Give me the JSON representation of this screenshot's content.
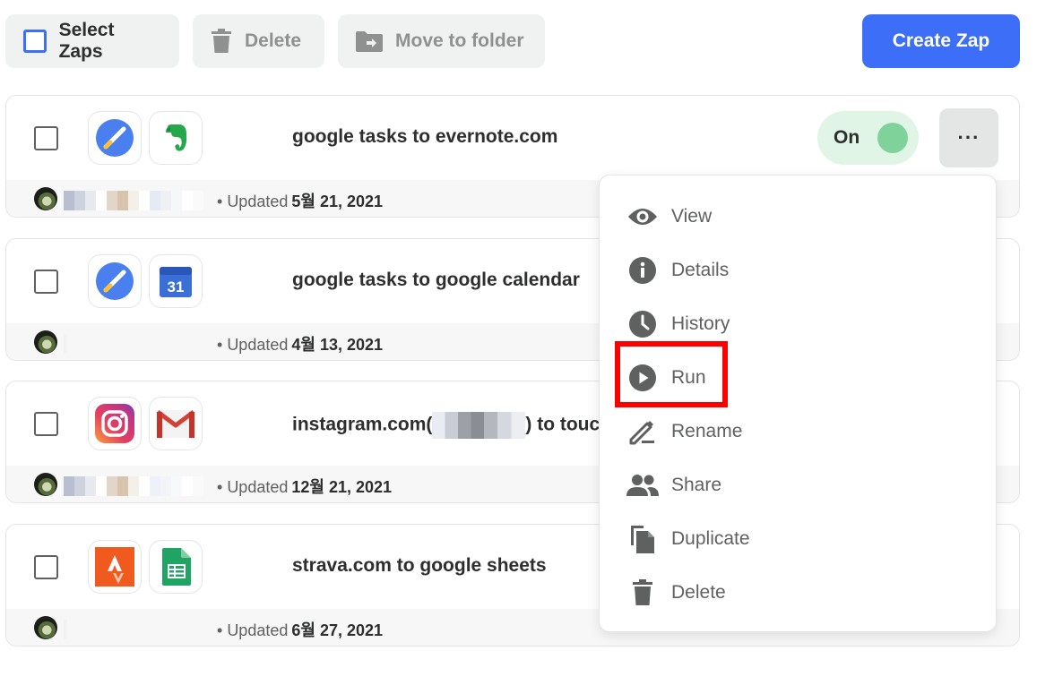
{
  "toolbar": {
    "select_label": "Select Zaps",
    "delete_label": "Delete",
    "move_label": "Move to folder",
    "create_label": "Create Zap"
  },
  "zaps": [
    {
      "title": "google tasks to evernote.com",
      "updated_label": "Updated",
      "updated_date": "5월 21, 2021",
      "status": "On",
      "apps": [
        "google-tasks-icon",
        "evernote-icon"
      ]
    },
    {
      "title": "google tasks to google calendar",
      "updated_label": "Updated",
      "updated_date": "4월 13, 2021",
      "apps": [
        "google-tasks-icon",
        "google-calendar-icon"
      ],
      "calendar_day": "31"
    },
    {
      "title_prefix": "instagram.com(",
      "title_suffix": ") to touc",
      "updated_label": "Updated",
      "updated_date": "12월 21, 2021",
      "apps": [
        "instagram-icon",
        "gmail-icon"
      ]
    },
    {
      "title": "strava.com to google sheets",
      "updated_label": "Updated",
      "updated_date": "6월 27, 2021",
      "apps": [
        "strava-icon",
        "google-sheets-icon"
      ]
    }
  ],
  "menu": {
    "items": [
      {
        "label": "View",
        "icon": "eye-icon"
      },
      {
        "label": "Details",
        "icon": "info-icon"
      },
      {
        "label": "History",
        "icon": "clock-icon"
      },
      {
        "label": "Run",
        "icon": "play-icon"
      },
      {
        "label": "Rename",
        "icon": "pencil-icon"
      },
      {
        "label": "Share",
        "icon": "people-icon"
      },
      {
        "label": "Duplicate",
        "icon": "copy-icon"
      },
      {
        "label": "Delete",
        "icon": "trash-icon"
      }
    ]
  },
  "colors": {
    "primary": "#3d6ef7",
    "toggle_on_bg": "#e0f5e6",
    "toggle_knob": "#7fd39a",
    "highlight": "#ff0000"
  }
}
